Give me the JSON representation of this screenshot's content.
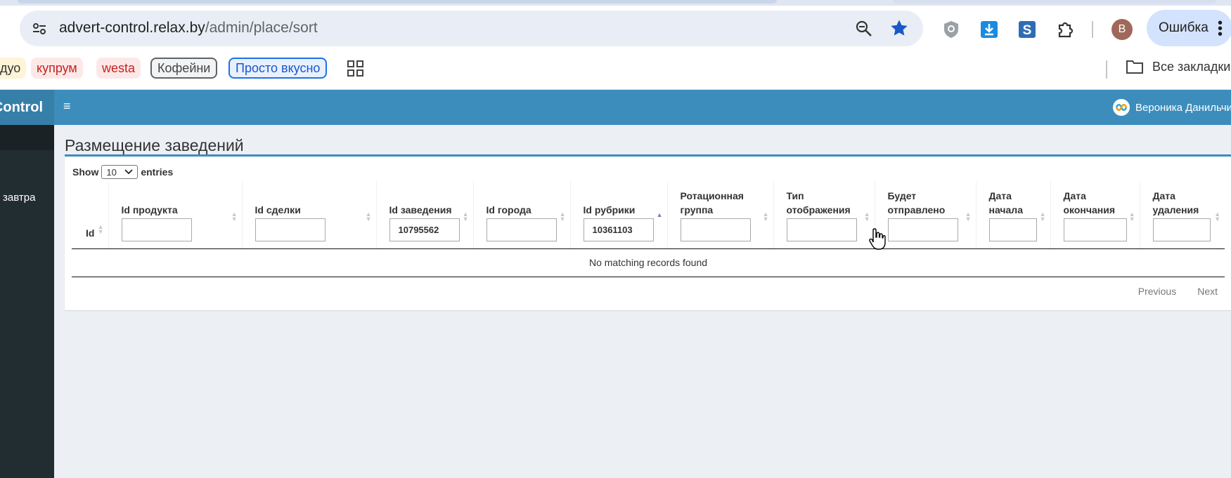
{
  "browser": {
    "url_host": "advert-control.relax.by",
    "url_path": "/admin/place/sort",
    "profile_initial": "В",
    "error_label": "Ошибка"
  },
  "bookmarks": {
    "items": [
      "дуо",
      "купрум",
      "westa",
      "Кофейни",
      "Просто вкусно"
    ],
    "folder_label": "Все закладки"
  },
  "app": {
    "brand": "Control",
    "user_name": "Вероника Данильчик",
    "sidebar_item": "завтра"
  },
  "page": {
    "title": "Размещение заведений",
    "show_label": "Show",
    "entries_value": "10",
    "entries_label": "entries",
    "columns": [
      {
        "label": "Id",
        "filter": null
      },
      {
        "label": "Id продукта",
        "filter": ""
      },
      {
        "label": "Id сделки",
        "filter": ""
      },
      {
        "label": "Id заведения",
        "filter": "10795562"
      },
      {
        "label": "Id города",
        "filter": ""
      },
      {
        "label": "Id рубрики",
        "filter": "10361103"
      },
      {
        "label": "Ротационная группа",
        "filter": ""
      },
      {
        "label": "Тип отображения",
        "filter": ""
      },
      {
        "label": "Будет отправлено",
        "filter": ""
      },
      {
        "label": "Дата начала",
        "filter": ""
      },
      {
        "label": "Дата окончания",
        "filter": ""
      },
      {
        "label": "Дата удаления",
        "filter": ""
      }
    ],
    "empty_message": "No matching records found",
    "previous_label": "Previous",
    "next_label": "Next"
  },
  "colors": {
    "header": "#3c8dbc",
    "sidebar": "#222d32",
    "content_bg": "#ecf0f5"
  }
}
